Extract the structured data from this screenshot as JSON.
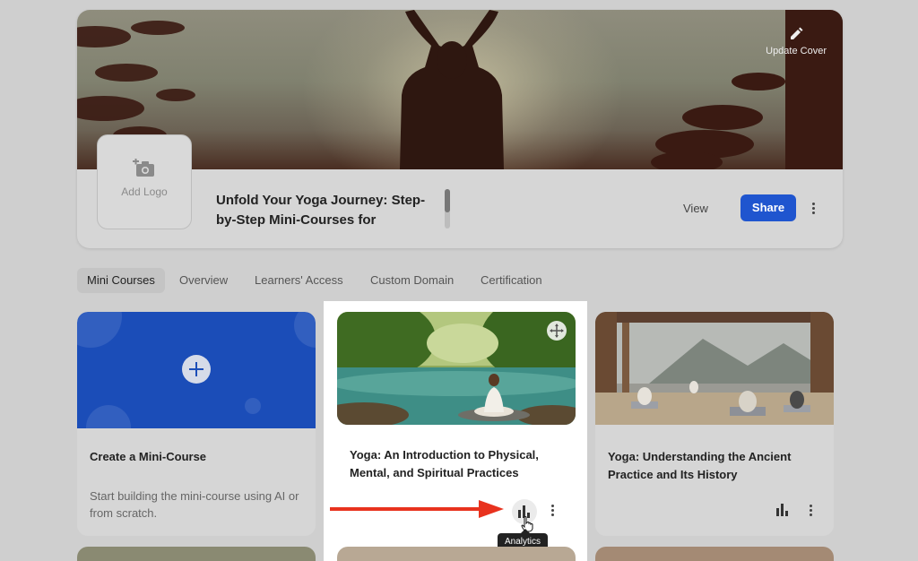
{
  "header": {
    "update_cover_label": "Update Cover",
    "add_logo_label": "Add Logo",
    "course_title": "Unfold Your Yoga Journey: Step-by-Step Mini-Courses for",
    "view_label": "View",
    "share_label": "Share"
  },
  "tabs": [
    {
      "label": "Mini Courses",
      "active": true
    },
    {
      "label": "Overview",
      "active": false
    },
    {
      "label": "Learners' Access",
      "active": false
    },
    {
      "label": "Custom Domain",
      "active": false
    },
    {
      "label": "Certification",
      "active": false
    }
  ],
  "cards": [
    {
      "title": "Create a Mini-Course",
      "description": "Start building the mini-course using AI or from scratch."
    },
    {
      "title": "Yoga: An Introduction to Physical, Mental, and Spiritual Practices",
      "tooltip": "Analytics"
    },
    {
      "title": "Yoga: Understanding the Ancient Practice and Its History"
    }
  ],
  "colors": {
    "accent": "#1f55cf",
    "create_card": "#1b4db8",
    "annotation_arrow": "#e8321e"
  },
  "icons": [
    "pencil-icon",
    "add-photo-icon",
    "more-vertical-icon",
    "plus-icon",
    "move-icon",
    "analytics-icon",
    "hand-cursor-icon"
  ]
}
